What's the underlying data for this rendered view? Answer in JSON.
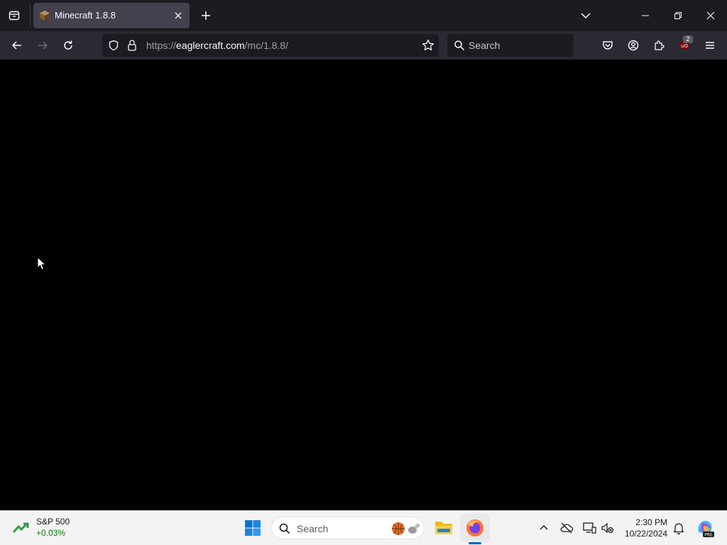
{
  "browser": {
    "tab": {
      "title": "Minecraft 1.8.8"
    },
    "url": {
      "prefix": "https://",
      "host": "eaglercraft.com",
      "path": "/mc/1.8.8/"
    },
    "search_placeholder": "Search",
    "extension_badge": "2"
  },
  "taskbar": {
    "stock": {
      "name": "S&P 500",
      "change": "+0.03%"
    },
    "search_placeholder": "Search",
    "clock": {
      "time": "2:30 PM",
      "date": "10/22/2024"
    }
  },
  "colors": {
    "content_bg": "#000000",
    "tabstrip_bg": "#1c1b22",
    "navbar_bg": "#2b2a33",
    "taskbar_bg": "#f3f3f3",
    "stock_positive": "#0e7a0d"
  }
}
